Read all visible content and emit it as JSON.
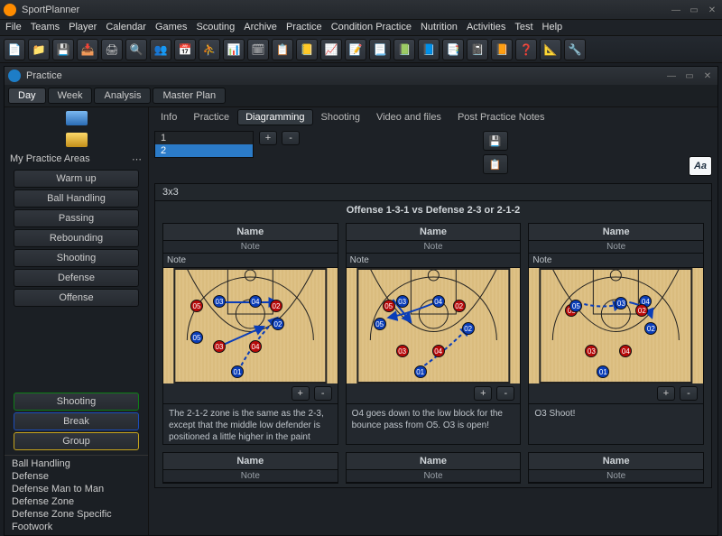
{
  "app": {
    "title": "SportPlanner"
  },
  "menu": [
    "File",
    "Teams",
    "Player",
    "Calendar",
    "Games",
    "Scouting",
    "Archive",
    "Practice",
    "Condition Practice",
    "Nutrition",
    "Activities",
    "Test",
    "Help"
  ],
  "toolbar_icons": [
    "📄",
    "📁",
    "💾",
    "📥",
    "🖨",
    "🔍",
    "👥",
    "📅",
    "⛹",
    "📊",
    "🗓",
    "📋",
    "📒",
    "📈",
    "📝",
    "📃",
    "📗",
    "📘",
    "📑",
    "📓",
    "📙",
    "❓",
    "📐",
    "🔧"
  ],
  "subwindow_title": "Practice",
  "view_tabs": [
    "Day",
    "Week",
    "Analysis",
    "Master Plan"
  ],
  "active_view_tab": 0,
  "sidebar": {
    "section": "My Practice Areas",
    "areas": [
      "Warm up",
      "Ball Handling",
      "Passing",
      "Rebounding",
      "Shooting",
      "Defense",
      "Offense"
    ],
    "session_blocks": [
      {
        "label": "Shooting",
        "cls": "green"
      },
      {
        "label": "Break",
        "cls": "blue"
      },
      {
        "label": "Group",
        "cls": "yellow"
      }
    ],
    "list": [
      "Ball Handling",
      "Defense",
      "Defense Man to Man",
      "Defense Zone",
      "Defense Zone Specific",
      "Footwork"
    ]
  },
  "sub_tabs": [
    "Info",
    "Practice",
    "Diagramming",
    "Shooting",
    "Video and files",
    "Post Practice Notes"
  ],
  "active_sub_tab": 2,
  "sequence": {
    "rows": [
      "1",
      "2"
    ],
    "selected": 1
  },
  "buttons": {
    "plus": "+",
    "minus": "-"
  },
  "panel": {
    "head": "3x3",
    "title": "Offense 1-3-1 vs Defense 2-3 or 2-1-2",
    "name_label": "Name",
    "note_static": "Note",
    "note_field": "Note",
    "diagrams": [
      {
        "desc": "The 2-1-2 zone is the same as the 2-3, except that the middle low defender is positioned a little higher in the paint"
      },
      {
        "desc": "O4 goes down to the low block for the bounce pass from O5. O3 is open!"
      },
      {
        "desc": "O3 Shoot!"
      }
    ],
    "second_row": true
  }
}
